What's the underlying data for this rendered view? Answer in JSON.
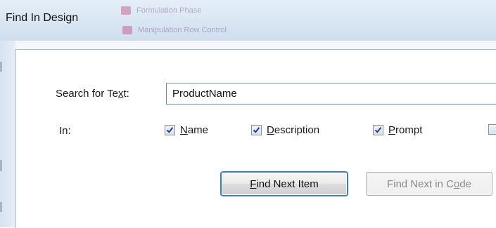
{
  "window": {
    "title": "Find In Design",
    "background_items": [
      {
        "label": "Formulation Phase"
      },
      {
        "label": "Manipulation Row Control"
      }
    ]
  },
  "search": {
    "label_pre": "Search for Te",
    "label_access": "x",
    "label_post": "t:",
    "value": "ProductName"
  },
  "in": {
    "label": "In:",
    "options": [
      {
        "access": "N",
        "rest": "ame",
        "checked": true
      },
      {
        "access": "D",
        "rest": "escription",
        "checked": true
      },
      {
        "access": "P",
        "rest": "rompt",
        "checked": true
      },
      {
        "access": "",
        "rest": "",
        "checked": false
      }
    ]
  },
  "buttons": {
    "find_next_item": {
      "access": "F",
      "rest": "ind Next Item"
    },
    "find_next_in_code": {
      "pre": "Find Next in C",
      "access": "o",
      "post": "de",
      "enabled": false
    }
  },
  "colors": {
    "default_button_border": "#3c7fb1",
    "checkmark": "#2a3b8f"
  }
}
